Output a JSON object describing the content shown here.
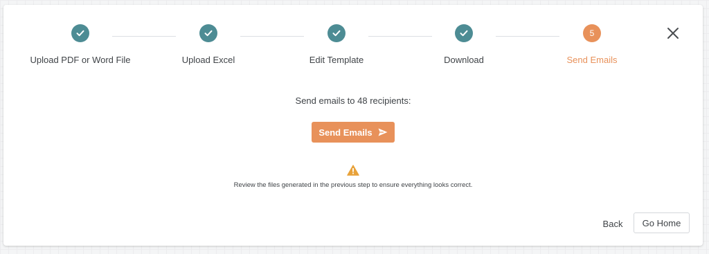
{
  "stepper": {
    "steps": [
      {
        "label": "Upload PDF or Word File",
        "status": "completed",
        "icon": "check-icon"
      },
      {
        "label": "Upload Excel",
        "status": "completed",
        "icon": "check-icon"
      },
      {
        "label": "Edit Template",
        "status": "completed",
        "icon": "check-icon"
      },
      {
        "label": "Download",
        "status": "completed",
        "icon": "check-icon"
      },
      {
        "label": "Send Emails",
        "status": "active",
        "number": "5"
      }
    ]
  },
  "close_icon": "close-icon",
  "main": {
    "recipients_text": "Send emails to 48 recipients:",
    "send_button_label": "Send Emails",
    "send_icon": "send-icon",
    "warning_icon": "warning-icon",
    "review_text": "Review the files generated in the previous step to ensure everything looks correct."
  },
  "footer": {
    "back_label": "Back",
    "home_label": "Go Home"
  },
  "colors": {
    "completed": "#4d8c94",
    "active": "#e8915a",
    "text": "#3f4347",
    "warning": "#e8a23a"
  }
}
